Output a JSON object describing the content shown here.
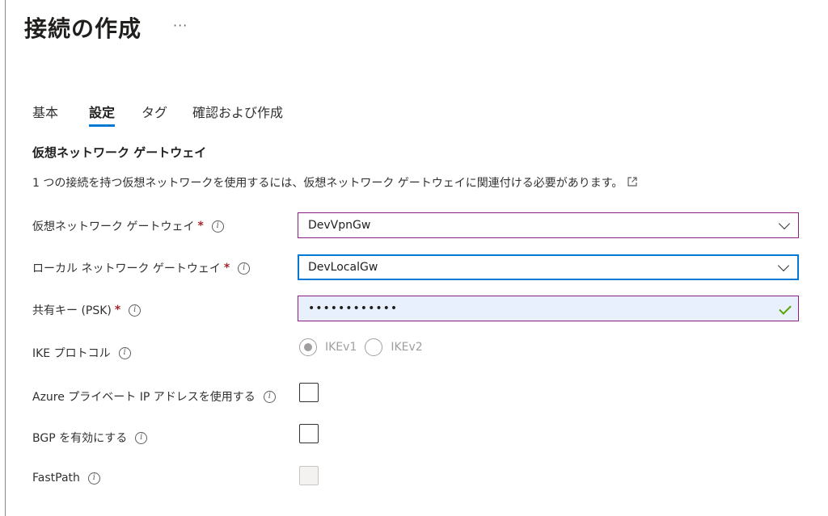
{
  "page": {
    "title": "接続の作成",
    "more": "···"
  },
  "tabs": [
    {
      "label": "基本",
      "active": false
    },
    {
      "label": "設定",
      "active": true
    },
    {
      "label": "タグ",
      "active": false
    },
    {
      "label": "確認および作成",
      "active": false
    }
  ],
  "section": {
    "title": "仮想ネットワーク ゲートウェイ",
    "description": "1 つの接続を持つ仮想ネットワークを使用するには、仮想ネットワーク ゲートウェイに関連付ける必要があります。",
    "external_link_icon": "external-link-icon"
  },
  "fields": {
    "vnet_gateway": {
      "label": "仮想ネットワーク ゲートウェイ",
      "required": "*",
      "value": "DevVpnGw"
    },
    "local_gateway": {
      "label": "ローカル ネットワーク ゲートウェイ",
      "required": "*",
      "value": "DevLocalGw"
    },
    "psk": {
      "label": "共有キー (PSK)",
      "required": "*",
      "value": "••••••••••••"
    },
    "ike": {
      "label": "IKE プロトコル",
      "options": [
        "IKEv1",
        "IKEv2"
      ],
      "selected": "IKEv1"
    },
    "azure_private_ip": {
      "label": "Azure プライベート IP アドレスを使用する",
      "checked": false
    },
    "bgp": {
      "label": "BGP を有効にする",
      "checked": false
    },
    "fastpath": {
      "label": "FastPath",
      "checked": false,
      "disabled": true
    }
  },
  "icons": {
    "info": "i"
  },
  "colors": {
    "accent": "#0078d4",
    "required": "#a4262c",
    "valid": "#57a300",
    "field_border": "#8a1f7f"
  }
}
